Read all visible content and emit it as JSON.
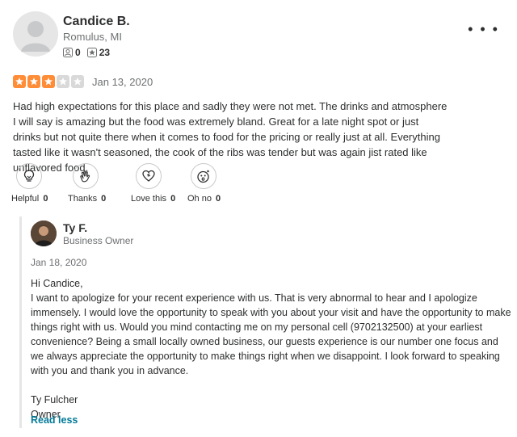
{
  "reviewer": {
    "name": "Candice B.",
    "location": "Romulus, MI",
    "friends": "0",
    "reviews": "23"
  },
  "rating": {
    "stars": 3,
    "max": 5,
    "date": "Jan 13, 2020"
  },
  "review": {
    "text": "Had high expectations for this place and sadly they were not met. The drinks and atmosphere I will say is amazing but the food was extremely bland. Great for a late night spot or just drinks but not quite there when it comes to food for the pricing or really just at all. Everything tasted like it wasn't seasoned, the cook of the ribs was tender but was again jist rated like unflavored food."
  },
  "reactions": [
    {
      "label": "Helpful",
      "count": "0",
      "icon": "lightbulb-icon"
    },
    {
      "label": "Thanks",
      "count": "0",
      "icon": "clapping-hands-icon"
    },
    {
      "label": "Love this",
      "count": "0",
      "icon": "heart-icon"
    },
    {
      "label": "Oh no",
      "count": "0",
      "icon": "shocked-face-icon"
    }
  ],
  "owner_reply": {
    "name": "Ty F.",
    "role": "Business Owner",
    "date": "Jan 18, 2020",
    "text": "Hi Candice,\nI want to apologize for your recent experience with us. That is very abnormal to hear and I apologize immensely. I would love the opportunity to speak with you about your visit and have the opportunity to make things right with us. Would you mind contacting me on my personal cell (9702132500) at your earliest convenience? Being a small locally owned business, our guests experience is our number one focus and we always appreciate the opportunity to make things right when we disappoint. I look forward to speaking with you and thank you in advance.\n\nTy Fulcher\nOwner",
    "read_less": "Read less"
  },
  "more_menu": "• • •",
  "colors": {
    "star_on": "#ff8c37",
    "star_off": "#d9d9d9",
    "link": "#027a97"
  }
}
